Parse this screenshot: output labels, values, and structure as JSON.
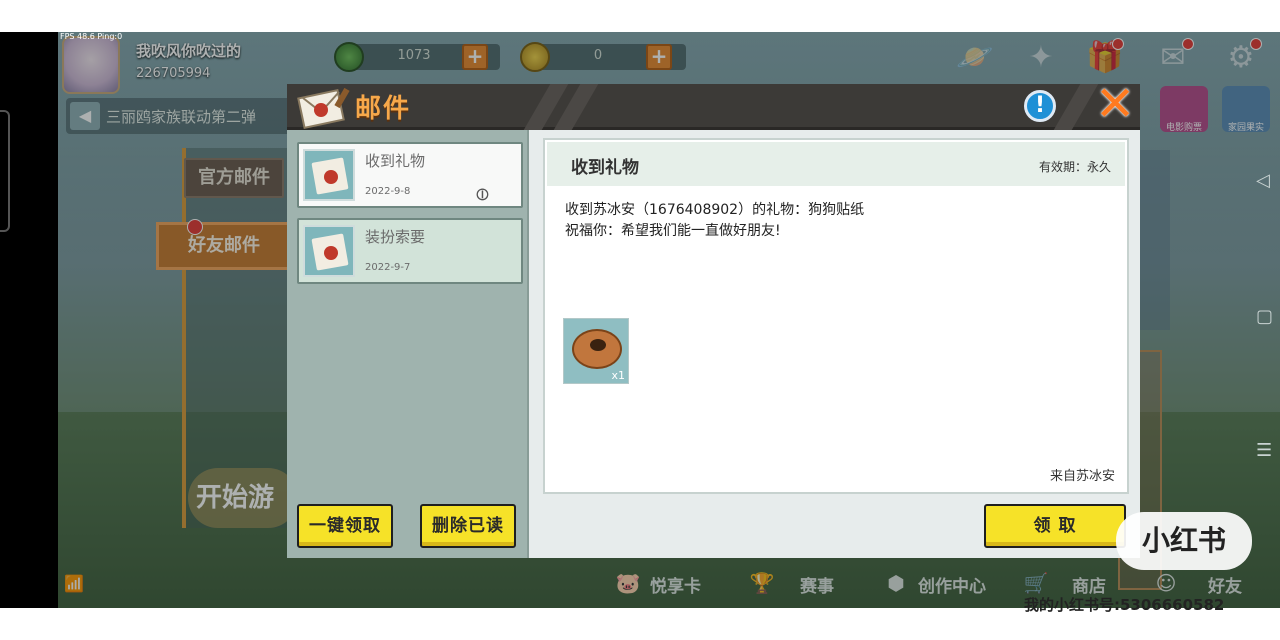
{
  "hud": {
    "fps": "FPS 48.6  Ping:0",
    "username": "我吹风你吹过的",
    "user_id": "226705994",
    "currency1": "1073",
    "currency2": "0",
    "plus": "+"
  },
  "banner": {
    "text": "三丽鸥家族联动第二弹"
  },
  "side_tabs": {
    "official": "官方邮件",
    "friend": "好友邮件"
  },
  "start_game": "开始游",
  "top_right_mini": {
    "item1": "电影购票",
    "item2": "家园果实"
  },
  "bottom_bar": {
    "card": "悦享卡",
    "events": "赛事",
    "creation": "创作中心",
    "shop": "商店",
    "friends": "好友"
  },
  "dialog": {
    "title": "邮件",
    "info": "!",
    "mails": [
      {
        "name": "收到礼物",
        "date": "2022-9-8"
      },
      {
        "name": "装扮索要",
        "date": "2022-9-7"
      }
    ],
    "claim_all_button": "一键领取",
    "delete_read_button": "删除已读",
    "claim_button": "领 取",
    "detail": {
      "title": "收到礼物",
      "expiry": "有效期：永久",
      "line1": "收到苏冰安（1676408902）的礼物：狗狗贴纸",
      "line2": "祝福你：希望我们能一直做好朋友!",
      "gift_qty": "x1",
      "from": "来自苏冰安"
    }
  },
  "watermark": {
    "logo": "小红书",
    "id": "我的小红书号:5306660582"
  },
  "colors": {
    "title_orange": "#f7a84a",
    "button_yellow": "#f6e228",
    "info_blue": "#1e90d6",
    "close_orange": "#ff7a1f"
  }
}
